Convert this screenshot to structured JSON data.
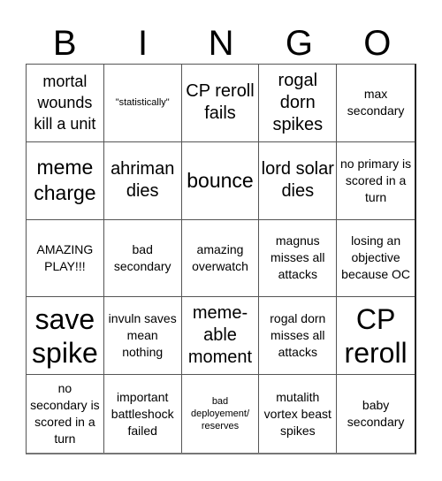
{
  "header": {
    "letters": [
      "B",
      "I",
      "N",
      "G",
      "O"
    ]
  },
  "cells": [
    {
      "text": "mortal wounds kill a unit",
      "size": "ml"
    },
    {
      "text": "\"statistically\"",
      "size": "xs"
    },
    {
      "text": "CP reroll fails",
      "size": "l"
    },
    {
      "text": "rogal dorn spikes",
      "size": "l"
    },
    {
      "text": "max secondary",
      "size": "s"
    },
    {
      "text": "meme charge",
      "size": "xl"
    },
    {
      "text": "ahriman dies",
      "size": "l"
    },
    {
      "text": "bounce",
      "size": "xl"
    },
    {
      "text": "lord solar dies",
      "size": "l"
    },
    {
      "text": "no primary is scored in a turn",
      "size": "s"
    },
    {
      "text": "AMAZING PLAY!!!",
      "size": "s"
    },
    {
      "text": "bad secondary",
      "size": "s"
    },
    {
      "text": "amazing overwatch",
      "size": "s"
    },
    {
      "text": "magnus misses all attacks",
      "size": "s"
    },
    {
      "text": "losing an objective because OC",
      "size": "s"
    },
    {
      "text": "save spike",
      "size": "xxl"
    },
    {
      "text": "invuln saves mean nothing",
      "size": "s"
    },
    {
      "text": "meme-able moment",
      "size": "l"
    },
    {
      "text": "rogal dorn misses all attacks",
      "size": "s"
    },
    {
      "text": "CP reroll",
      "size": "xxl"
    },
    {
      "text": "no secondary is scored in a turn",
      "size": "s"
    },
    {
      "text": "important battleshock failed",
      "size": "s"
    },
    {
      "text": "bad deployement/ reserves",
      "size": "xs"
    },
    {
      "text": "mutalith vortex beast spikes",
      "size": "s"
    },
    {
      "text": "baby secondary",
      "size": "s"
    }
  ]
}
